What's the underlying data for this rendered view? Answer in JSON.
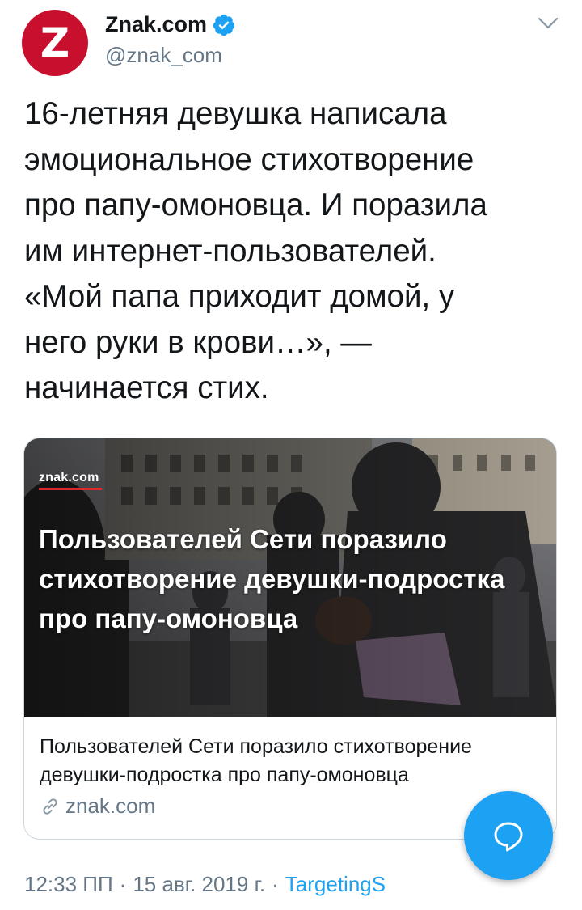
{
  "account": {
    "avatar_letter": "Z",
    "name": "Znak.com",
    "handle": "@znak_com",
    "verified": true
  },
  "tweet": {
    "text": "16-летняя девушка написала\nэмоциональное стихотворение\nпро папу-омоновца. И поразила\nим интернет-пользователей.\n«Мой папа приходит домой, у\nнего руки в крови…», —\nначинается стих."
  },
  "card": {
    "logo": "znak.com",
    "headline": "Пользователей Сети поразило стихотворение девушки-подростка про папу-омоновца",
    "title": "Пользователей Сети поразило стихотворение девушки-подростка про папу-омоновца",
    "domain": "znak.com",
    "link_icon": "link-icon"
  },
  "footer": {
    "time": "12:33 ПП",
    "separator": "·",
    "date": "15 авг. 2019 г.",
    "source": "TargetingS"
  },
  "colors": {
    "brand_red": "#c8102e",
    "twitter_blue": "#1da1f2",
    "muted": "#657786"
  }
}
